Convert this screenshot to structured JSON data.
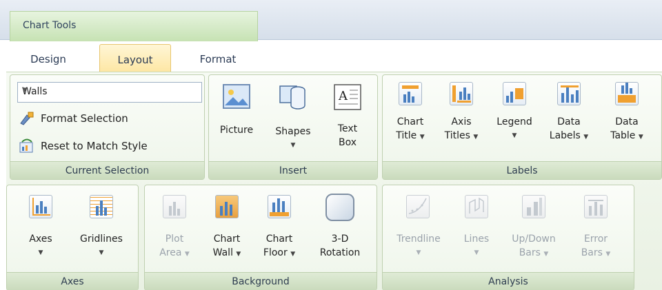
{
  "context_tab": {
    "label": "Chart Tools"
  },
  "tabs": {
    "design": "Design",
    "layout": "Layout",
    "format": "Format"
  },
  "current_selection": {
    "dropdown_value": "Walls",
    "format_selection": "Format Selection",
    "reset_to_match_style": "Reset to Match Style",
    "group_label": "Current Selection"
  },
  "insert": {
    "picture": "Picture",
    "shapes_line1": "Shapes",
    "text_box_line1": "Text",
    "text_box_line2": "Box",
    "group_label": "Insert"
  },
  "labels": {
    "chart_title_line1": "Chart",
    "chart_title_line2": "Title",
    "axis_titles_line1": "Axis",
    "axis_titles_line2": "Titles",
    "legend_line1": "Legend",
    "data_labels_line1": "Data",
    "data_labels_line2": "Labels",
    "data_table_line1": "Data",
    "data_table_line2": "Table",
    "group_label": "Labels"
  },
  "axes": {
    "axes": "Axes",
    "gridlines": "Gridlines",
    "group_label": "Axes"
  },
  "background": {
    "plot_area_line1": "Plot",
    "plot_area_line2": "Area",
    "chart_wall_line1": "Chart",
    "chart_wall_line2": "Wall",
    "chart_floor_line1": "Chart",
    "chart_floor_line2": "Floor",
    "rotation_line1": "3-D",
    "rotation_line2": "Rotation",
    "group_label": "Background"
  },
  "analysis": {
    "trendline": "Trendline",
    "lines": "Lines",
    "updown_line1": "Up/Down",
    "updown_line2": "Bars",
    "error_line1": "Error",
    "error_line2": "Bars",
    "group_label": "Analysis"
  },
  "arrow_glyph": "▼",
  "colors": {
    "accent_green": "#c6e2b3",
    "active_tab": "#fde6a2",
    "chart_orange": "#f0a030",
    "chart_blue": "#4a7fc0"
  }
}
